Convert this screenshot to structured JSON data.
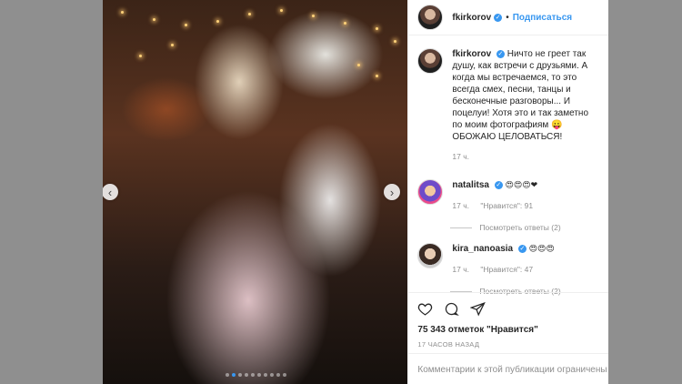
{
  "post": {
    "author": "fkirkorov",
    "follow_label": "Подписаться",
    "separator": "•",
    "caption": "Ничто не греет так душу, как встречи с друзьями. А когда мы встречаемся, то это всегда смех, песни, танцы и бесконечные разговоры... И поцелуи! Хотя это и так заметно по моим фотографиям 😛ОБОЖАЮ ЦЕЛОВАТЬСЯ!",
    "caption_time": "17 ч.",
    "likes": "75 343 отметок \"Нравится\"",
    "posted_ago": "17 ЧАСОВ НАЗАД",
    "comments_restricted": "Комментарии к этой публикации ограничены"
  },
  "comments": [
    {
      "user": "natalitsa",
      "text": "😍😍😍❤",
      "time": "17 ч.",
      "likes": "\"Нравится\": 91",
      "view_replies": "Посмотреть ответы (2)"
    },
    {
      "user": "kira_nanoasia",
      "text": "😍😍😍",
      "time": "17 ч.",
      "likes": "\"Нравится\": 47",
      "view_replies": "Посмотреть ответы (2)"
    }
  ],
  "carousel": {
    "count": 10,
    "active_index": 1
  },
  "icons": {
    "verified": "verified-badge-icon",
    "like": "heart-icon",
    "comment": "comment-bubble-icon",
    "share": "paper-plane-icon",
    "prev": "chevron-left-icon",
    "next": "chevron-right-icon"
  },
  "colors": {
    "accent": "#3897f0",
    "backdrop": "#8f8f8f",
    "muted": "#8e8e8e"
  }
}
